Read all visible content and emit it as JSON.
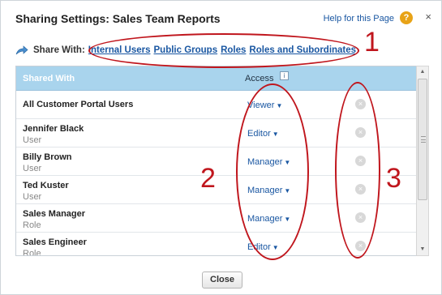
{
  "dialog": {
    "title": "Sharing Settings: Sales Team Reports",
    "help_label": "Help for this Page",
    "help_icon": "?",
    "close_icon": "×"
  },
  "share_with": {
    "label": "Share With:",
    "links": [
      "Internal Users",
      "Public Groups",
      "Roles",
      "Roles and Subordinates"
    ]
  },
  "table": {
    "headers": {
      "shared_with": "Shared With",
      "access": "Access",
      "info_icon": "i"
    },
    "rows": [
      {
        "name": "All Customer Portal Users",
        "type": "",
        "access": "Viewer"
      },
      {
        "name": "Jennifer Black",
        "type": "User",
        "access": "Editor"
      },
      {
        "name": "Billy Brown",
        "type": "User",
        "access": "Manager"
      },
      {
        "name": "Ted Kuster",
        "type": "User",
        "access": "Manager"
      },
      {
        "name": "Sales Manager",
        "type": "Role",
        "access": "Manager"
      },
      {
        "name": "Sales Engineer",
        "type": "Role",
        "access": "Editor"
      }
    ],
    "caret": "▼",
    "remove_icon": "×"
  },
  "footer": {
    "close_label": "Close"
  },
  "annotations": {
    "callout_1": "1",
    "callout_2": "2",
    "callout_3": "3"
  },
  "colors": {
    "header_bg": "#a9d4ed",
    "link": "#1a57a2",
    "annotation": "#c0161d",
    "help_icon": "#e8a317"
  }
}
